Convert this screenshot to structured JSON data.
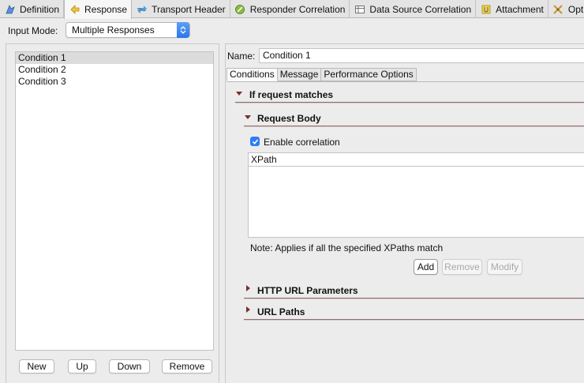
{
  "tabs": [
    {
      "label": "Definition",
      "icon": "definition-icon"
    },
    {
      "label": "Response",
      "icon": "response-icon"
    },
    {
      "label": "Transport Header",
      "icon": "transport-header-icon"
    },
    {
      "label": "Responder Correlation",
      "icon": "responder-correlation-icon"
    },
    {
      "label": "Data Source Correlation",
      "icon": "data-source-icon"
    },
    {
      "label": "Attachment",
      "icon": "attachment-icon"
    },
    {
      "label": "Options",
      "icon": "options-icon"
    }
  ],
  "input_mode": {
    "label": "Input Mode:",
    "value": "Multiple Responses"
  },
  "conditions": [
    "Condition 1",
    "Condition 2",
    "Condition 3"
  ],
  "list_buttons": {
    "new": "New",
    "up": "Up",
    "down": "Down",
    "remove": "Remove"
  },
  "name": {
    "label": "Name:",
    "value": "Condition 1"
  },
  "subtabs": [
    "Conditions",
    "Message",
    "Performance Options"
  ],
  "sections": {
    "if_request": "If request matches",
    "request_body": "Request Body",
    "http_url": "HTTP URL Parameters",
    "url_paths": "URL Paths"
  },
  "enable_correlation": "Enable correlation",
  "xpath_header": "XPath",
  "note": "Note: Applies if all the specified XPaths match",
  "xpath_buttons": {
    "add": "Add",
    "remove": "Remove",
    "modify": "Modify"
  },
  "colors": {
    "accent": "#2f7cf6",
    "section_line": "#8f6d6d",
    "triangle": "#7a2d2d"
  }
}
